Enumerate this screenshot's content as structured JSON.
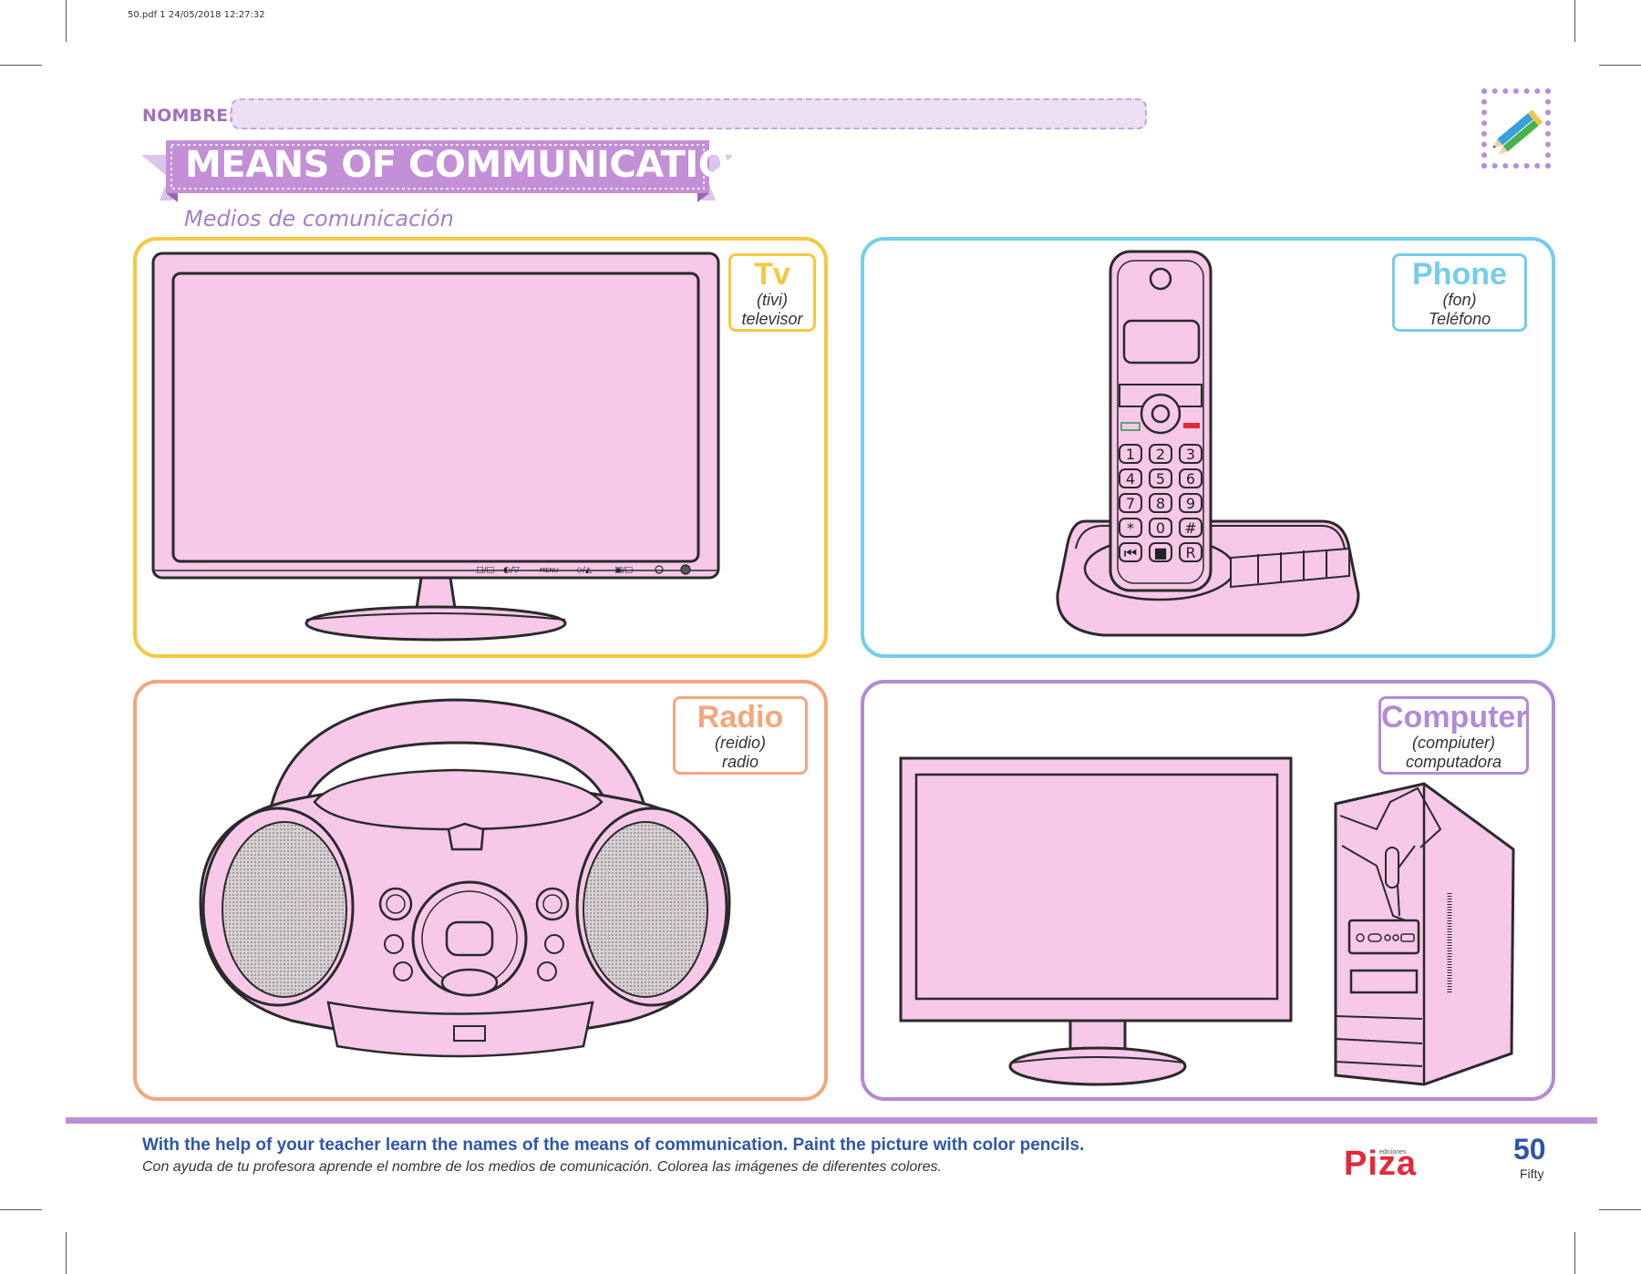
{
  "file_info": "50.pdf  1  24/05/2018  12:27:32",
  "header": {
    "name_label": "NOMBRE:",
    "title": "MEANS OF COMMUNICATION",
    "subtitle": "Medios de comunicación"
  },
  "panels": [
    {
      "english": "Tv",
      "pronunciation": "(tivi)",
      "spanish": "televisor",
      "color": "#f5c842"
    },
    {
      "english": "Phone",
      "pronunciation": "(fon)",
      "spanish": "Teléfono",
      "color": "#74cdea"
    },
    {
      "english": "Radio",
      "pronunciation": "(reidio)",
      "spanish": "radio",
      "color": "#f2a77d"
    },
    {
      "english": "Computer",
      "pronunciation": "(compiuter)",
      "spanish": "computadora",
      "color": "#b38ad4"
    }
  ],
  "tv_buttons": [
    "□/□",
    "◐/▽",
    "MENU",
    "◇/◭",
    "▣/□"
  ],
  "phone_keys": [
    "1",
    "2",
    "3",
    "4",
    "5",
    "6",
    "7",
    "8",
    "9",
    "*",
    "0",
    "#",
    "⏮",
    "■",
    "R"
  ],
  "footer": {
    "instruction_en": "With the help of your teacher learn the names of the means of communication. Paint the picture with color pencils.",
    "instruction_es": "Con ayuda de tu profesora aprende el nombre de los medios de comunicación. Colorea las imágenes de diferentes colores.",
    "logo_sub": "ediciones",
    "logo": "Piza",
    "page_number": "50",
    "page_word": "Fifty"
  },
  "colors": {
    "fill": "#f7c8e8",
    "title_banner": "#c38fd6",
    "accent_purple": "#a070c0",
    "instruction_blue": "#2e56a8"
  },
  "icons": [
    "pencil-icon"
  ]
}
